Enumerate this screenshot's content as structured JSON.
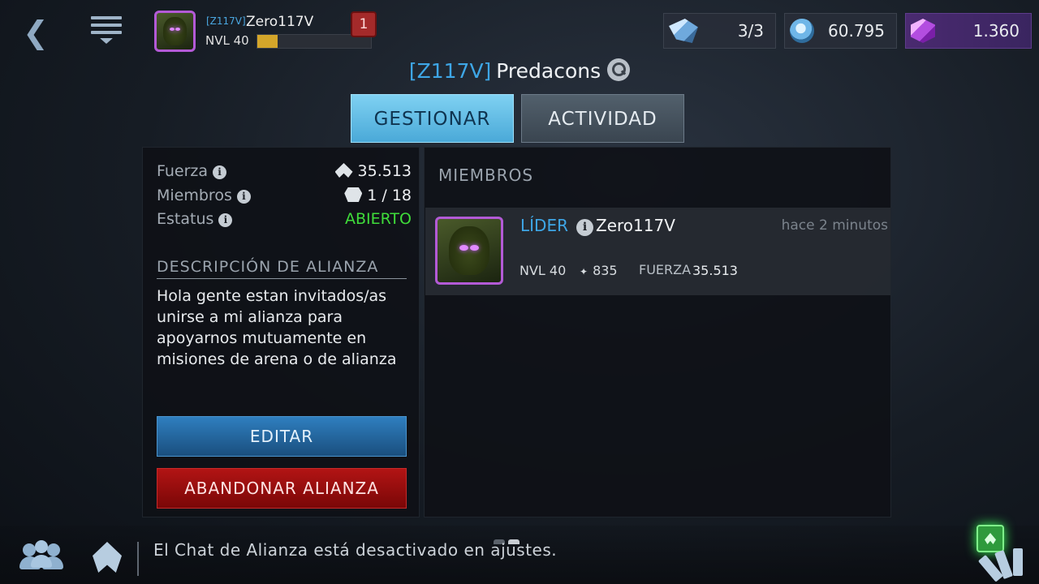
{
  "header": {
    "back_icon": "chevron-left-icon",
    "menu_icon": "menu-icon",
    "player": {
      "tag": "[Z117V]",
      "name": "Zero117V",
      "level_label": "NVL 40",
      "xp_progress": 0.18,
      "notification_count": "1"
    },
    "resources": [
      {
        "icon": "energy-icon",
        "value": "3/3"
      },
      {
        "icon": "credits-icon",
        "value": "60.795"
      },
      {
        "icon": "gems-icon",
        "value": "1.360"
      }
    ]
  },
  "alliance": {
    "tag": "[Z117V]",
    "name": "Predacons"
  },
  "tabs": [
    {
      "label": "GESTIONAR",
      "active": true
    },
    {
      "label": "ACTIVIDAD",
      "active": false
    }
  ],
  "stats": {
    "power_label": "Fuerza",
    "power_value": "35.513",
    "members_label": "Miembros",
    "members_value": "1 / 18",
    "status_label": "Estatus",
    "status_value": "ABIERTO"
  },
  "description": {
    "title": "DESCRIPCIÓN DE ALIANZA",
    "text": "Hola gente estan invitados/as unirse a mi alianza para apoyarnos mutuamente en misiones de arena o de alianza"
  },
  "buttons": {
    "edit": "EDITAR",
    "leave": "ABANDONAR ALIANZA"
  },
  "members": {
    "heading": "MIEMBROS",
    "list": [
      {
        "role": "LÍDER",
        "name": "Zero117V",
        "last_seen": "hace 2 minutos",
        "level": "NVL 40",
        "rank": "835",
        "power_label": "FUERZA",
        "power": "35.513"
      }
    ]
  },
  "chat": {
    "message": "El Chat de Alianza está desactivado en ajustes."
  },
  "colors": {
    "accent_blue": "#3ea6e6",
    "status_open": "#3fdc3a",
    "leave_red": "#b21414",
    "edit_blue": "#2f7fbf"
  }
}
